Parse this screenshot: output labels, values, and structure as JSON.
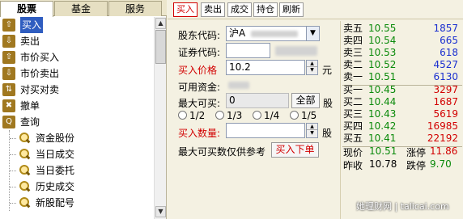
{
  "tabs": [
    "股票",
    "基金",
    "服务"
  ],
  "tree": {
    "items": [
      {
        "label": "买入",
        "icon": "buy-icon",
        "selected": true
      },
      {
        "label": "卖出",
        "icon": "sell-icon"
      },
      {
        "label": "市价买入",
        "icon": "market-buy-icon"
      },
      {
        "label": "市价卖出",
        "icon": "market-sell-icon"
      },
      {
        "label": "对买对卖",
        "icon": "swap-icon"
      },
      {
        "label": "撤单",
        "icon": "cancel-order-icon"
      },
      {
        "label": "查询",
        "icon": "query-icon"
      }
    ],
    "sub_items": [
      "资金股份",
      "当日成交",
      "当日委托",
      "历史成交",
      "新股配号"
    ]
  },
  "toolbar": [
    "买入",
    "卖出",
    "成交",
    "持仓",
    "刷新"
  ],
  "form": {
    "holder_label": "股东代码:",
    "holder_value": "沪A",
    "code_label": "证券代码:",
    "price_label": "买入价格",
    "price_value": "10.2",
    "price_unit": "元",
    "cash_label": "可用资金:",
    "max_label": "最大可买:",
    "max_value": "0",
    "all_button": "全部",
    "max_unit": "股",
    "ratios": [
      "1/2",
      "1/3",
      "1/4",
      "1/5"
    ],
    "qty_label": "买入数量:",
    "qty_unit": "股",
    "note": "最大可买数仅供参考",
    "submit_button": "买入下单"
  },
  "quote": {
    "sell": [
      {
        "label": "卖五",
        "price": "10.55",
        "vol": "1857"
      },
      {
        "label": "卖四",
        "price": "10.54",
        "vol": "665"
      },
      {
        "label": "卖三",
        "price": "10.53",
        "vol": "618"
      },
      {
        "label": "卖二",
        "price": "10.52",
        "vol": "4527"
      },
      {
        "label": "卖一",
        "price": "10.51",
        "vol": "6130"
      }
    ],
    "buy": [
      {
        "label": "买一",
        "price": "10.45",
        "vol": "3297"
      },
      {
        "label": "买二",
        "price": "10.44",
        "vol": "1687"
      },
      {
        "label": "买三",
        "price": "10.43",
        "vol": "5619"
      },
      {
        "label": "买四",
        "price": "10.42",
        "vol": "16985"
      },
      {
        "label": "买五",
        "price": "10.41",
        "vol": "22192"
      }
    ],
    "now_label": "现价",
    "now_value": "10.51",
    "limit_up_label": "涨停",
    "limit_up_value": "11.86",
    "prev_label": "昨收",
    "prev_value": "10.78",
    "limit_down_label": "跌停",
    "limit_down_value": "9.70"
  },
  "watermark": "她理财网 | talicai.com"
}
